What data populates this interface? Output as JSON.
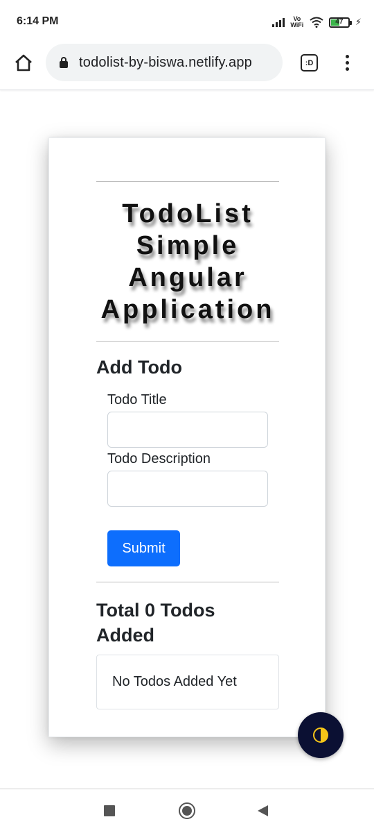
{
  "status_bar": {
    "time": "6:14 PM",
    "network_label": "Vo WiFi",
    "battery_percent": "47"
  },
  "browser": {
    "url": "todolist-by-biswa.netlify.app",
    "tabs_label": ":D"
  },
  "app": {
    "title": "TodoList Simple Angular Application",
    "add_section_heading": "Add Todo",
    "title_label": "Todo Title",
    "title_value": "",
    "description_label": "Todo Description",
    "description_value": "",
    "submit_label": "Submit",
    "total_text": "Total 0 Todos Added",
    "empty_text": "No Todos Added Yet"
  },
  "icons": {
    "home": "home-icon",
    "lock": "lock-icon",
    "menu": "more-vert-icon",
    "theme": "theme-toggle-icon"
  },
  "colors": {
    "primary": "#0d6efd",
    "fab_bg": "#0b1033",
    "fab_accent": "#f5c518",
    "battery_fill": "#3bb54a"
  }
}
